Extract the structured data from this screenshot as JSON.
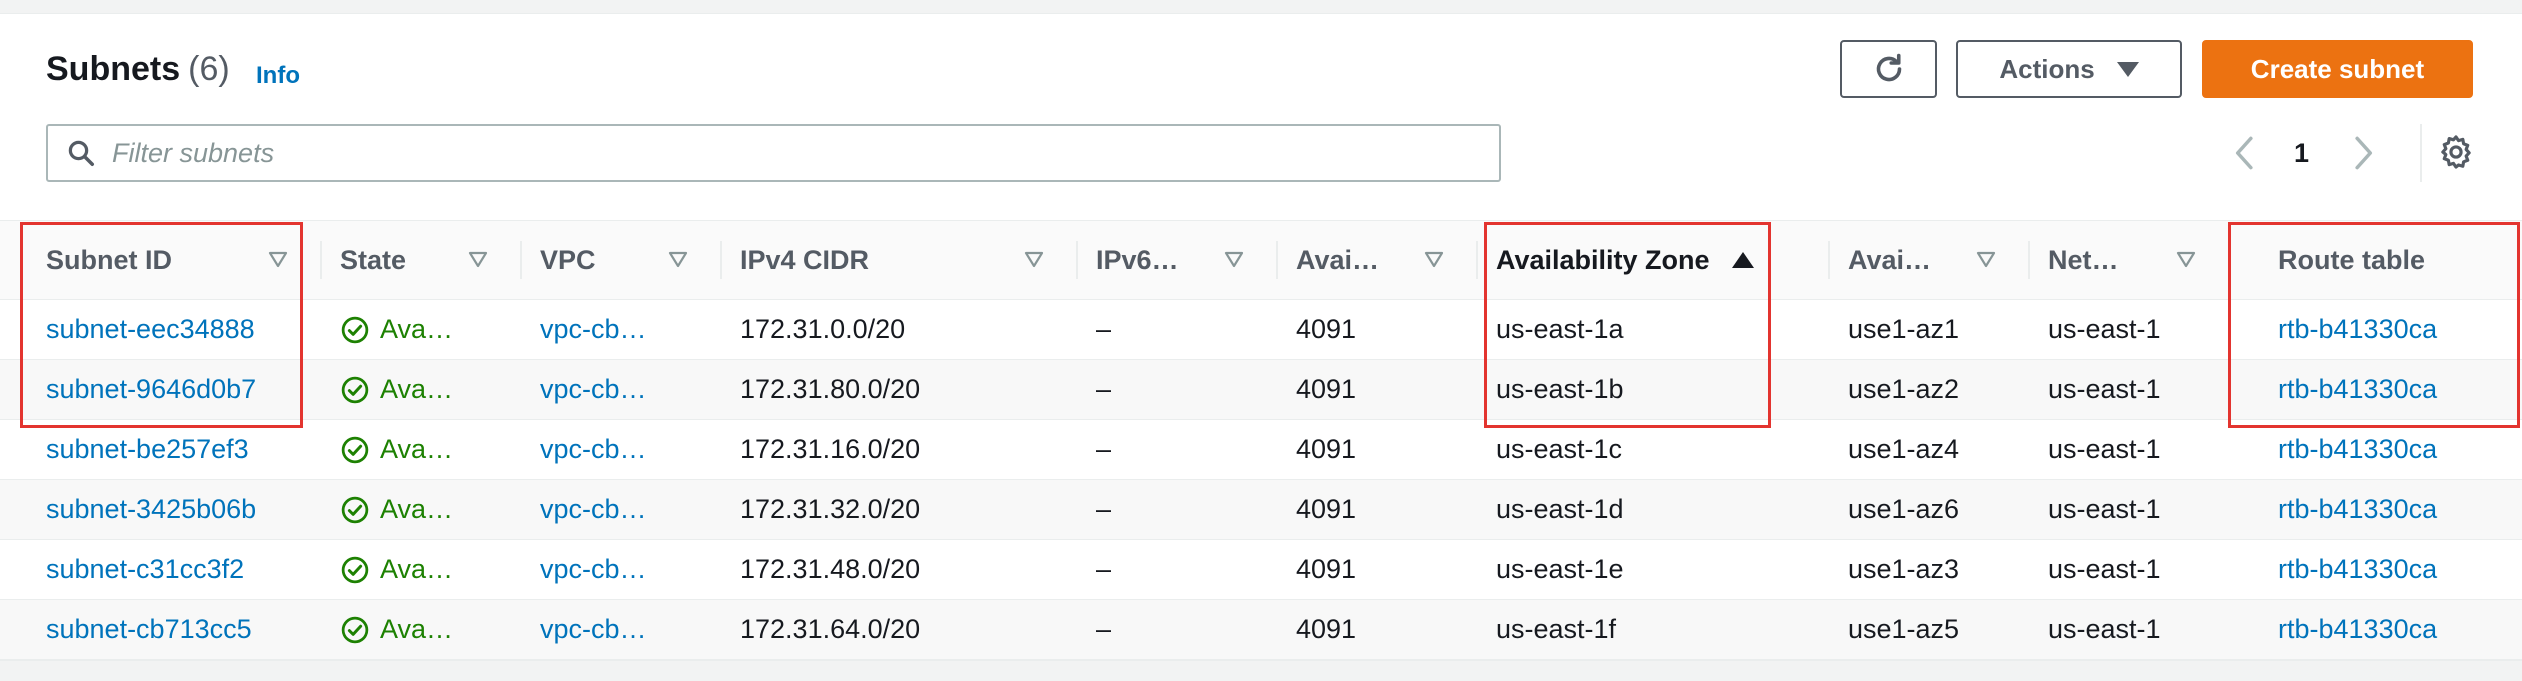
{
  "header": {
    "title": "Subnets",
    "count": "(6)",
    "info": "Info",
    "actions_label": "Actions",
    "create_label": "Create subnet",
    "refresh_icon": "refresh-icon"
  },
  "search": {
    "placeholder": "Filter subnets"
  },
  "pagination": {
    "current_page": "1"
  },
  "columns": [
    "Subnet ID",
    "State",
    "VPC",
    "IPv4 CIDR",
    "IPv6…",
    "Avai…",
    "Availability Zone",
    "Avai…",
    "Net…",
    "Route table"
  ],
  "sorted_column": "Availability Zone",
  "sort_direction": "ascending",
  "rows": [
    {
      "subnet_id": "subnet-eec34888",
      "state": "Ava…",
      "vpc": "vpc-cb…",
      "ipv4": "172.31.0.0/20",
      "ipv6": "–",
      "available_ips": "4091",
      "az": "us-east-1a",
      "az_id": "use1-az1",
      "network_border": "us-east-1",
      "route_table": "rtb-b41330ca"
    },
    {
      "subnet_id": "subnet-9646d0b7",
      "state": "Ava…",
      "vpc": "vpc-cb…",
      "ipv4": "172.31.80.0/20",
      "ipv6": "–",
      "available_ips": "4091",
      "az": "us-east-1b",
      "az_id": "use1-az2",
      "network_border": "us-east-1",
      "route_table": "rtb-b41330ca"
    },
    {
      "subnet_id": "subnet-be257ef3",
      "state": "Ava…",
      "vpc": "vpc-cb…",
      "ipv4": "172.31.16.0/20",
      "ipv6": "–",
      "available_ips": "4091",
      "az": "us-east-1c",
      "az_id": "use1-az4",
      "network_border": "us-east-1",
      "route_table": "rtb-b41330ca"
    },
    {
      "subnet_id": "subnet-3425b06b",
      "state": "Ava…",
      "vpc": "vpc-cb…",
      "ipv4": "172.31.32.0/20",
      "ipv6": "–",
      "available_ips": "4091",
      "az": "us-east-1d",
      "az_id": "use1-az6",
      "network_border": "us-east-1",
      "route_table": "rtb-b41330ca"
    },
    {
      "subnet_id": "subnet-c31cc3f2",
      "state": "Ava…",
      "vpc": "vpc-cb…",
      "ipv4": "172.31.48.0/20",
      "ipv6": "–",
      "available_ips": "4091",
      "az": "us-east-1e",
      "az_id": "use1-az3",
      "network_border": "us-east-1",
      "route_table": "rtb-b41330ca"
    },
    {
      "subnet_id": "subnet-cb713cc5",
      "state": "Ava…",
      "vpc": "vpc-cb…",
      "ipv4": "172.31.64.0/20",
      "ipv6": "–",
      "available_ips": "4091",
      "az": "us-east-1f",
      "az_id": "use1-az5",
      "network_border": "us-east-1",
      "route_table": "rtb-b41330ca"
    }
  ],
  "colors": {
    "link": "#0073bb",
    "primary_button": "#ec7211",
    "status_available": "#1d8102",
    "highlight_box": "#e3342f"
  },
  "highlighted_columns": [
    "Subnet ID",
    "Availability Zone",
    "Route table"
  ]
}
